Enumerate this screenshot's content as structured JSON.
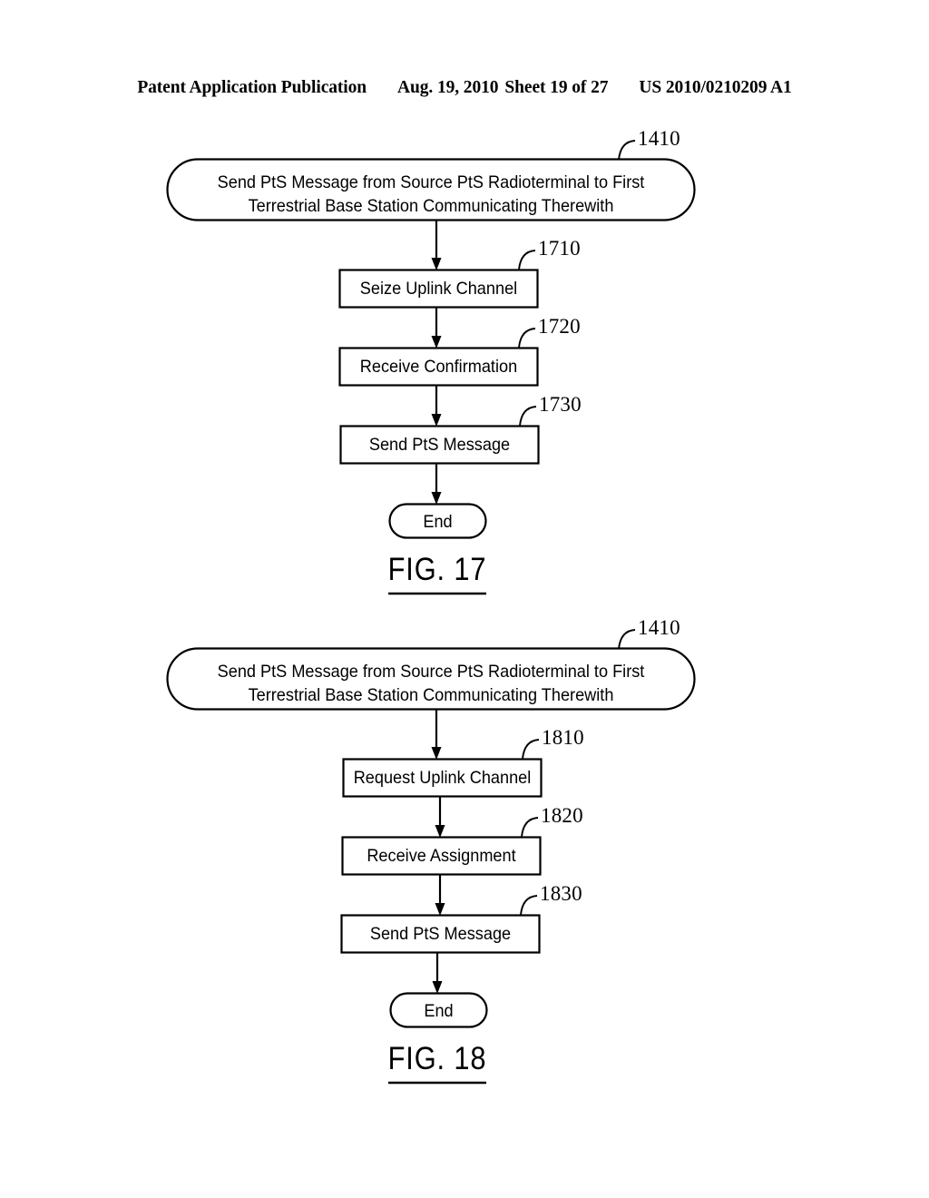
{
  "header": {
    "publication": "Patent Application Publication",
    "date": "Aug. 19, 2010",
    "sheet": "Sheet 19 of 27",
    "patent_number": "US 2010/0210209 A1"
  },
  "figures": [
    {
      "caption": "FIG. 17",
      "nodes": [
        {
          "id": "fig17-start",
          "shape": "stadium",
          "text": "Send PtS Message from Source PtS Radioterminal to First\nTerrestrial Base Station Communicating Therewith",
          "ref": "1410"
        },
        {
          "id": "fig17-step1",
          "shape": "rect",
          "text": "Seize Uplink Channel",
          "ref": "1710"
        },
        {
          "id": "fig17-step2",
          "shape": "rect",
          "text": "Receive Confirmation",
          "ref": "1720"
        },
        {
          "id": "fig17-step3",
          "shape": "rect",
          "text": "Send PtS Message",
          "ref": "1730"
        },
        {
          "id": "fig17-end",
          "shape": "stadium",
          "text": "End",
          "ref": ""
        }
      ]
    },
    {
      "caption": "FIG. 18",
      "nodes": [
        {
          "id": "fig18-start",
          "shape": "stadium",
          "text": "Send PtS Message from Source PtS Radioterminal to First\nTerrestrial Base Station Communicating Therewith",
          "ref": "1410"
        },
        {
          "id": "fig18-step1",
          "shape": "rect",
          "text": "Request Uplink Channel",
          "ref": "1810"
        },
        {
          "id": "fig18-step2",
          "shape": "rect",
          "text": "Receive Assignment",
          "ref": "1820"
        },
        {
          "id": "fig18-step3",
          "shape": "rect",
          "text": "Send PtS Message",
          "ref": "1830"
        },
        {
          "id": "fig18-end",
          "shape": "stadium",
          "text": "End",
          "ref": ""
        }
      ]
    }
  ]
}
